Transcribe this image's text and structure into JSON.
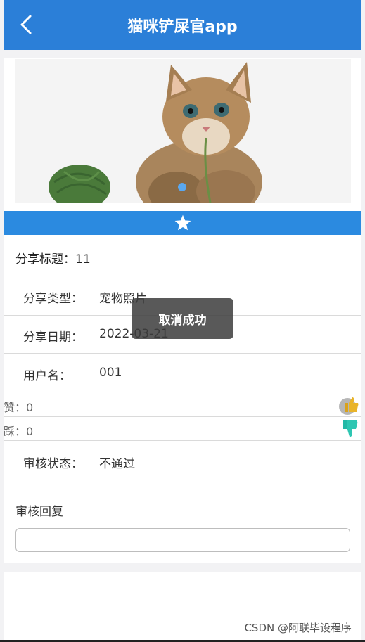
{
  "header": {
    "title": "猫咪铲屎官app"
  },
  "banner": {
    "alt": "kitten-with-yarn-photo"
  },
  "favorite": {
    "icon": "star-icon"
  },
  "share": {
    "title_label": "分享标题：",
    "title_value": "11",
    "type_label": "分享类型：",
    "type_value": "宠物照片",
    "date_label": "分享日期：",
    "date_value": "2022-03-21",
    "user_label": "用户名：",
    "user_value": "001"
  },
  "votes": {
    "like_label": "赞：",
    "like_value": "0",
    "dislike_label": "踩：",
    "dislike_value": "0"
  },
  "review": {
    "status_label": "审核状态：",
    "status_value": "不通过",
    "reply_label": "审核回复",
    "reply_value": ""
  },
  "toast": {
    "message": "取消成功"
  },
  "watermark": "CSDN @阿联毕设程序"
}
